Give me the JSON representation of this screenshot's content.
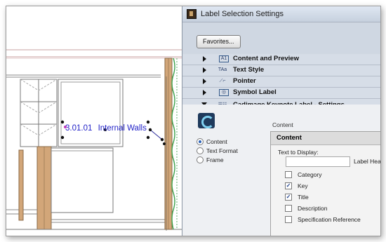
{
  "drawing": {
    "label_code": "3.01.01",
    "label_text": "Internal Walls"
  },
  "dialog": {
    "title": "Label Selection Settings",
    "favorites_button": "Favorites...",
    "sections": [
      {
        "label": "Content and Preview",
        "icon": "A1",
        "expanded": false
      },
      {
        "label": "Text Style",
        "icon": "TAa",
        "expanded": false
      },
      {
        "label": "Pointer",
        "icon": "pointer",
        "expanded": false
      },
      {
        "label": "Symbol Label",
        "icon": "symbol",
        "expanded": false
      },
      {
        "label": "Cadimage Keynote Label - Settings",
        "icon": "keynote",
        "expanded": true
      }
    ],
    "panel": {
      "radio_options": [
        "Content",
        "Text Format",
        "Frame"
      ],
      "selected_radio": "Content",
      "content_caption": "Content",
      "group_title": "Content",
      "text_to_display_label": "Text to Display:",
      "text_to_display_value": "",
      "label_header_label": "Label Head",
      "checkboxes": [
        {
          "label": "Category",
          "checked": false
        },
        {
          "label": "Key",
          "checked": true
        },
        {
          "label": "Title",
          "checked": true
        },
        {
          "label": "Description",
          "checked": false
        },
        {
          "label": "Specification Reference",
          "checked": false
        }
      ]
    }
  }
}
